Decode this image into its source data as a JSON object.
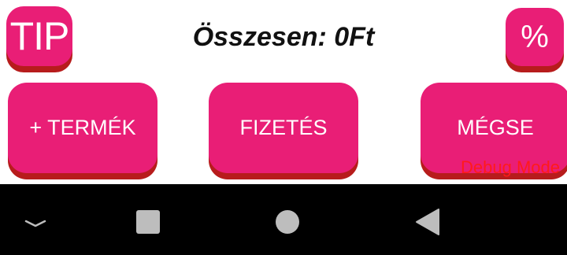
{
  "header": {
    "tip_label": "TIP",
    "total_text": "Összesen: 0Ft",
    "percent_label": "%"
  },
  "actions": {
    "add_product_label": "+ TERMÉK",
    "pay_label": "FIZETÉS",
    "cancel_label": "MÉGSE"
  },
  "debug": {
    "label": "Debug Mode"
  },
  "navbar": {
    "icons": [
      "chevron-down-icon",
      "recents-square-icon",
      "home-circle-icon",
      "back-triangle-icon"
    ]
  },
  "colors": {
    "button": "#e91e76",
    "button_shadow": "#b71c1c",
    "debug_text": "#ff1a1a",
    "navbar": "#000000",
    "nav_icon": "#bdbdbd"
  }
}
